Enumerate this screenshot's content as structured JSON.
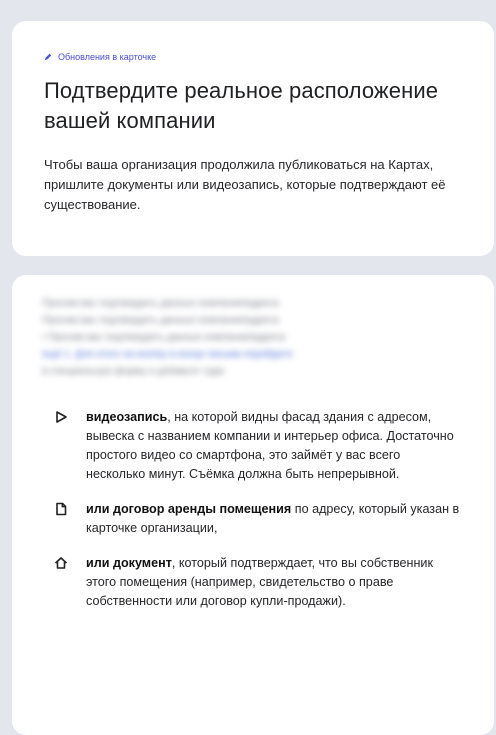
{
  "top_card": {
    "tag_label": "Обновления в карточке",
    "title": "Подтвердите реальное расположение вашей компании",
    "lead": "Чтобы ваша организация продолжила публиковаться на Картах, пришлите документы или видеозапись, которые подтверждают её существование."
  },
  "bottom_card": {
    "blurred_lines": [
      "Просим вас подтвердить данные компании/адреса",
      "Просим вас подтвердить данные компании/адреса",
      "• Просим вас подтвердить данные компании/адреса",
      "ещё 1. Для этого на кнопку в конце письма перейдите",
      "в специальную форму и добавьте туда:"
    ],
    "items": [
      {
        "icon": "play-icon",
        "bold": "видеозапись",
        "text": ", на которой видны фасад здания с адресом, вывеска с названием компании и интерьер офиса. Достаточно простого видео со смартфона, это займёт у вас всего несколько минут. Съёмка должна быть непрерывной."
      },
      {
        "icon": "document-icon",
        "bold": "или договор аренды помещения",
        "text": " по адресу, который указан в карточке организации,"
      },
      {
        "icon": "home-icon",
        "bold": "или документ",
        "text": ", который подтверждает, что вы собственник этого помещения (например, свидетельство о праве собственности или договор купли-продажи)."
      }
    ]
  },
  "colors": {
    "accent": "#4a4fd3",
    "background": "#e4e6ee",
    "card": "#ffffff"
  }
}
